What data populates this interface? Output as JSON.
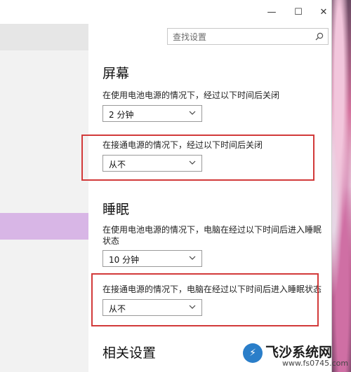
{
  "window": {
    "controls": {
      "minimize": "—",
      "maximize": "☐",
      "close": "✕"
    }
  },
  "search": {
    "placeholder": "查找设置"
  },
  "screen": {
    "title": "屏幕",
    "battery_label": "在使用电池电源的情况下，经过以下时间后关闭",
    "battery_value": "2 分钟",
    "plugged_label": "在接通电源的情况下，经过以下时间后关闭",
    "plugged_value": "从不"
  },
  "sleep": {
    "title": "睡眠",
    "battery_label_line1": "在使用电池电源的情况下，电脑在经过以下时间后进入睡眠",
    "battery_label_line2": "状态",
    "battery_value": "10 分钟",
    "plugged_label": "在接通电源的情况下，电脑在经过以下时间后进入睡眠状态",
    "plugged_value": "从不"
  },
  "related": {
    "title": "相关设置"
  },
  "watermark": {
    "title": "飞沙系统网",
    "url": "www.fs0745.com"
  },
  "colors": {
    "highlight": "#d23a3a",
    "sidebar_selected": "#d8b6e6"
  }
}
